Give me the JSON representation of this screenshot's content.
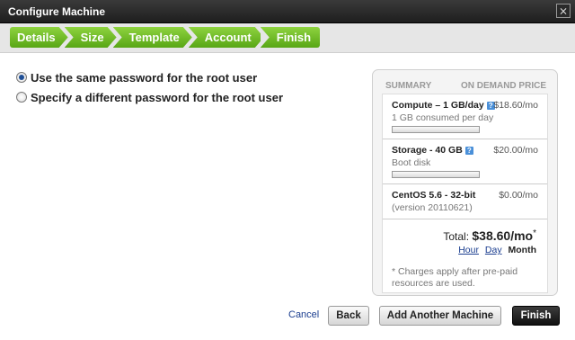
{
  "window": {
    "title": "Configure Machine",
    "close_glyph": "⨯"
  },
  "wizard": {
    "steps": [
      "Details",
      "Size",
      "Template",
      "Account",
      "Finish"
    ]
  },
  "password_options": [
    {
      "label": "Use the same password for the root user",
      "selected": true
    },
    {
      "label": "Specify a different password for the root user",
      "selected": false
    }
  ],
  "summary": {
    "header_left": "SUMMARY",
    "header_right": "ON DEMAND PRICE",
    "items": [
      {
        "name": "Compute – 1 GB/day",
        "price": "$18.60/mo",
        "detail": "1 GB consumed per day",
        "has_info": true,
        "has_bar": true,
        "bar_fill_pct": 0
      },
      {
        "name": "Storage - 40 GB",
        "price": "$20.00/mo",
        "detail": "Boot disk",
        "has_info": true,
        "has_bar": true,
        "bar_fill_pct": 0
      },
      {
        "name": "CentOS 5.6 - 32-bit",
        "price": "$0.00/mo",
        "detail": "(version 20110621)",
        "has_info": false,
        "has_bar": false
      }
    ],
    "total_label": "Total:",
    "total_value": "$38.60/mo",
    "total_mark": "*",
    "periods": {
      "hour": "Hour",
      "day": "Day",
      "month": "Month"
    },
    "note": "* Charges apply after pre-paid resources are used.",
    "info_glyph": "?"
  },
  "footer": {
    "cancel": "Cancel",
    "back": "Back",
    "add_another": "Add Another Machine",
    "finish": "Finish"
  },
  "colors": {
    "accent_green": "#58a615",
    "link_blue": "#1a3d8f"
  }
}
